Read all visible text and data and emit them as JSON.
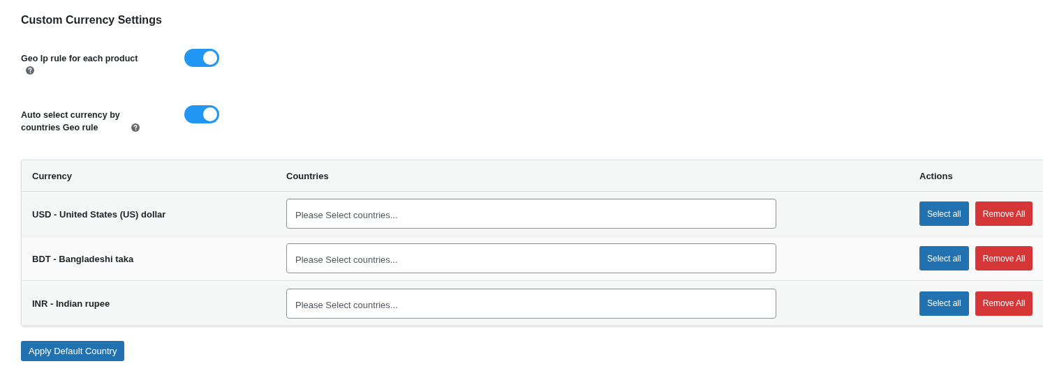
{
  "title": "Custom Currency Settings",
  "settings": [
    {
      "label": "Geo Ip rule for each product",
      "help": true,
      "on": true
    },
    {
      "label": "Auto select currency by countries Geo rule",
      "help": true,
      "on": true
    }
  ],
  "table": {
    "columns": [
      "Currency",
      "Countries",
      "Actions"
    ],
    "rows": [
      {
        "currency": "USD - United States (US) dollar",
        "placeholder": "Please Select countries...",
        "actions": [
          "Select all",
          "Remove All"
        ]
      },
      {
        "currency": "BDT - Bangladeshi taka",
        "placeholder": "Please Select countries...",
        "actions": [
          "Select all",
          "Remove All"
        ]
      },
      {
        "currency": "INR - Indian rupee",
        "placeholder": "Please Select countries...",
        "actions": [
          "Select all",
          "Remove All"
        ]
      }
    ]
  },
  "apply_button": "Apply Default Country"
}
